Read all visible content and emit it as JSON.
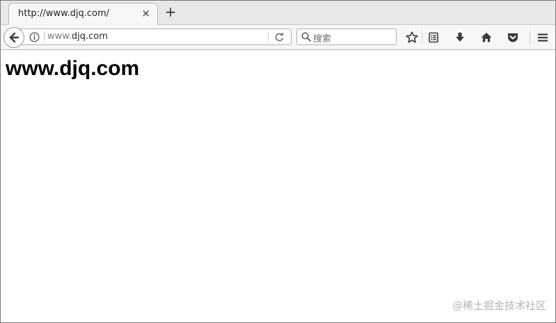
{
  "tab": {
    "title": "http://www.djq.com/",
    "close_glyph": "×",
    "new_tab_glyph": "+"
  },
  "address": {
    "url_prefix": "www.",
    "url_host": "djq.com"
  },
  "search": {
    "placeholder": "搜索"
  },
  "toolbar": {
    "icons": [
      "star-icon",
      "reading-list-icon",
      "download-icon",
      "home-icon",
      "pocket-icon",
      "menu-icon"
    ]
  },
  "page": {
    "heading": "www.djq.com"
  },
  "watermark": {
    "text": "@稀土掘金技术社区"
  },
  "colors": {
    "tab_strip": "#e8e8e8",
    "toolbar": "#f7f7f7",
    "icon": "#3a3a3a",
    "watermark": "#b4b4b4"
  }
}
